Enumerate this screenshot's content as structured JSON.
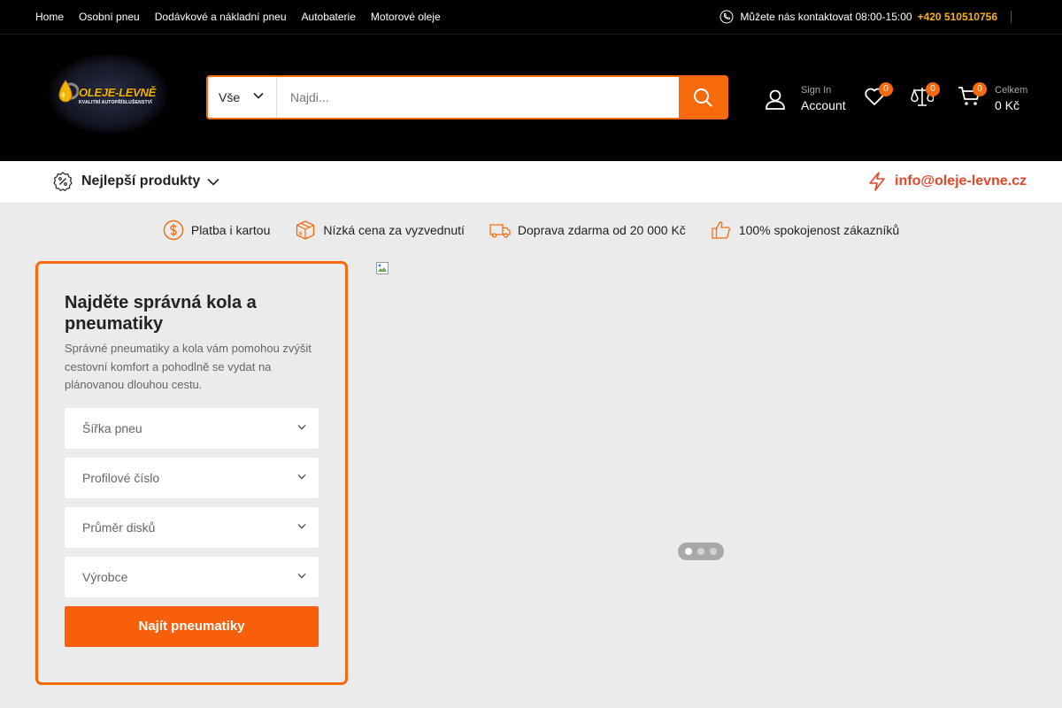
{
  "topnav": {
    "links": [
      "Home",
      "Osobní pneu",
      "Dodávkové a nákladní pneu",
      "Autobaterie",
      "Motorové oleje"
    ]
  },
  "contact": {
    "text": "Můžete nás kontaktovat 08:00-15:00",
    "phone": "+420 510510756"
  },
  "logo": {
    "brand": "OLEJE-LEVNĚ",
    "tagline": "KVALITNÍ AUTOPŘÍSLUŠENSTVÍ"
  },
  "search": {
    "category": "Vše",
    "placeholder": "Najdi..."
  },
  "account": {
    "small": "Sign In",
    "big": "Account"
  },
  "wishlist": {
    "count": "0"
  },
  "compare": {
    "count": "0"
  },
  "cart": {
    "count": "0",
    "small": "Celkem",
    "total": "0 Kč"
  },
  "catbar": {
    "best_products": "Nejlepší produkty",
    "email": "info@oleje-levne.cz"
  },
  "features": [
    "Platba i kartou",
    "Nízká cena za vyzvednutí",
    "Doprava zdarma od 20 000 Kč",
    "100% spokojenost zákazníků"
  ],
  "finder": {
    "title": "Najděte správná kola a pneumatiky",
    "description": "Správné pneumatiky a kola vám pomohou zvýšit cestovní komfort a pohodlně se vydat na plánovanou dlouhou cestu.",
    "fields": [
      "Šířka pneu",
      "Profilové číslo",
      "Průměr disků",
      "Výrobce"
    ],
    "button": "Najít pneumatiky"
  },
  "slider": {
    "dot_count": 3,
    "active_dot": 1
  },
  "colors": {
    "accent": "#f76a0c",
    "phone": "#f7b11a",
    "email": "#e2462b"
  }
}
